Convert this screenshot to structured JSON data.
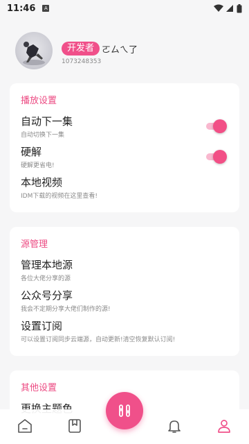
{
  "status_bar": {
    "time": "11:46",
    "notification_letter": "A"
  },
  "profile": {
    "badge": "开发者",
    "nickname": "ㄛㄙㄟ了",
    "uid": "1073248353"
  },
  "playback": {
    "title": "播放设置",
    "items": [
      {
        "title": "自动下一集",
        "subtitle": "自动切换下一集",
        "toggle_on": true
      },
      {
        "title": "硬解",
        "subtitle": "硬解更省电!",
        "toggle_on": true
      },
      {
        "title": "本地视频",
        "subtitle": "IDM下载的视频在这里查看!"
      }
    ]
  },
  "sources": {
    "title": "源管理",
    "items": [
      {
        "title": "管理本地源",
        "subtitle": "各位大佬分享的源"
      },
      {
        "title": "公众号分享",
        "subtitle": "我会不定期分享大佬们制作的源!"
      },
      {
        "title": "设置订阅",
        "subtitle": "可以设置订阅同步云端源，自动更新!清空恢复默认订阅!"
      }
    ]
  },
  "other": {
    "title": "其他设置",
    "items": [
      {
        "title": "更换主题色"
      }
    ]
  },
  "colors": {
    "accent": "#f0508a",
    "section_title": "#ec4a82",
    "background": "#f6f6f7"
  },
  "bottom_nav": {
    "items": [
      "home-icon",
      "bookmark-icon",
      "tools-icon",
      "bell-icon",
      "profile-icon"
    ],
    "active": "profile-icon"
  }
}
